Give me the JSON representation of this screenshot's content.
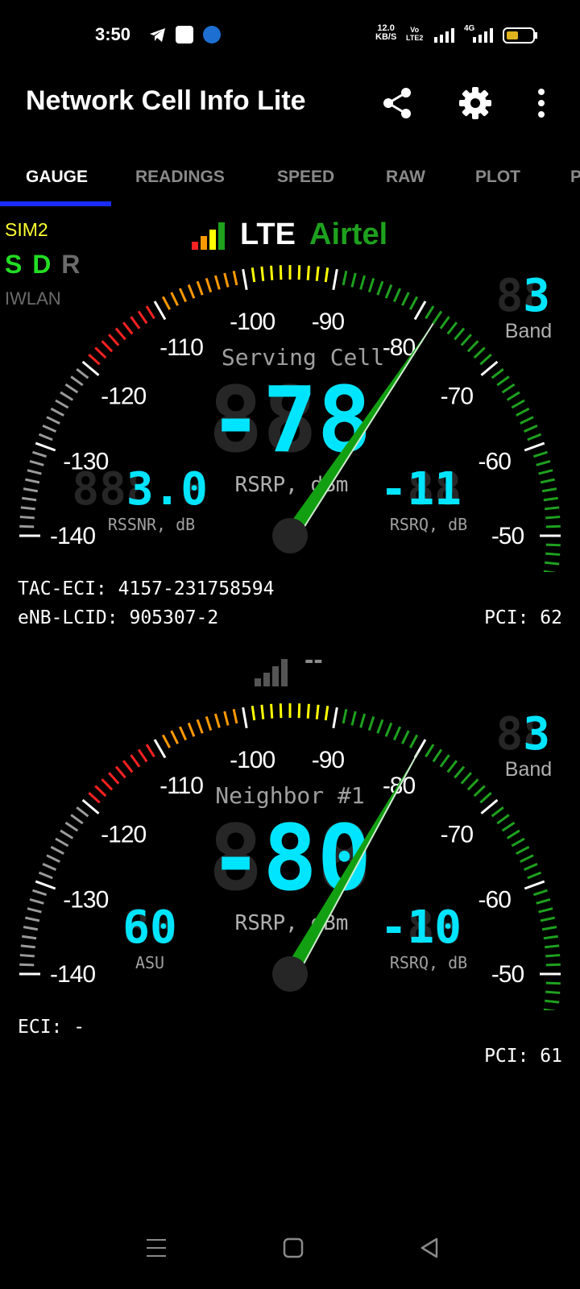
{
  "status_bar": {
    "time": "3:50",
    "net_speed_value": "12.0",
    "net_speed_unit": "KB/S",
    "volte_top": "Vo",
    "volte_bottom": "LTE2",
    "network_badge": "4G",
    "battery_color": "#e0b21e",
    "icons": [
      "telegram-icon",
      "app-notification-icon",
      "b-app-icon",
      "wifi-signal-icon",
      "cell-signal-icon",
      "battery-icon"
    ]
  },
  "app_bar": {
    "title": "Network Cell Info Lite",
    "icons": [
      "share-icon",
      "settings-gear-icon",
      "more-vert-icon"
    ]
  },
  "tabs": [
    {
      "label": "GAUGE",
      "active": true
    },
    {
      "label": "READINGS",
      "active": false
    },
    {
      "label": "SPEED",
      "active": false
    },
    {
      "label": "RAW",
      "active": false
    },
    {
      "label": "PLOT",
      "active": false
    },
    {
      "label": "P",
      "active": false
    }
  ],
  "sim": {
    "label": "SIM2",
    "s": "S",
    "d": "D",
    "r": "R",
    "iwlan": "IWLAN"
  },
  "serving": {
    "network_type": "LTE",
    "operator": "Airtel",
    "gauge_title": "Serving Cell",
    "rsrp_value": "-78",
    "rsrp_label": "RSRP, dBm",
    "left_value": "3.0",
    "left_ghost": "888.8",
    "left_label": "RSSNR, dB",
    "right_value": "-11",
    "right_ghost": "-88",
    "right_label": "RSRQ, dB",
    "band_value": "3",
    "band_ghost": "88",
    "band_label": "Band",
    "needle_value": -78,
    "tac_eci": "TAC-ECI: 4157-231758594",
    "enb_lcid": "eNB-LCID: 905307-2",
    "pci": "PCI: 62"
  },
  "neighbor": {
    "network_type": "--",
    "gauge_title": "Neighbor #1",
    "rsrp_value": "-80",
    "rsrp_label": "RSRP, dBm",
    "left_value": "60",
    "left_ghost": "88",
    "left_label": "ASU",
    "right_value": "-10",
    "right_ghost": "-88",
    "right_label": "RSRQ, dB",
    "band_value": "3",
    "band_ghost": "88",
    "band_label": "Band",
    "needle_value": -80,
    "eci": "ECI: -",
    "pci": "PCI: 61"
  },
  "gauge_scale": {
    "min": -140,
    "max": -45,
    "labels": [
      "-140",
      "-130",
      "-120",
      "-110",
      "-100",
      "-90",
      "-80",
      "-70",
      "-60",
      "-50"
    ],
    "colors": {
      "excellent": "#1ea11e",
      "good": "#ffff00",
      "fair": "#ff9900",
      "poor": "#ff2222",
      "none": "#9a9a9a"
    }
  },
  "nav_bar": {
    "icons": [
      "recents-icon",
      "home-icon",
      "back-icon"
    ]
  }
}
